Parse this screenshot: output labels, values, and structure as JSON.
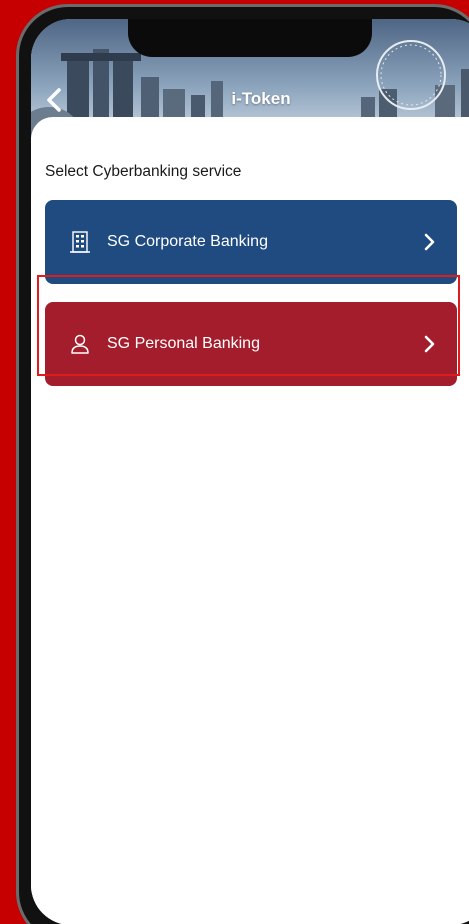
{
  "header": {
    "title": "i-Token",
    "back_icon": "chevron-left-icon"
  },
  "prompt": "Select Cyberbanking service",
  "services": [
    {
      "label": "SG Corporate Banking",
      "icon": "building-icon",
      "color": "#1f4b80"
    },
    {
      "label": "SG Personal Banking",
      "icon": "person-icon",
      "color": "#a31d2d"
    }
  ],
  "colors": {
    "background": "#c60000",
    "highlight_border": "#e11b1b"
  }
}
